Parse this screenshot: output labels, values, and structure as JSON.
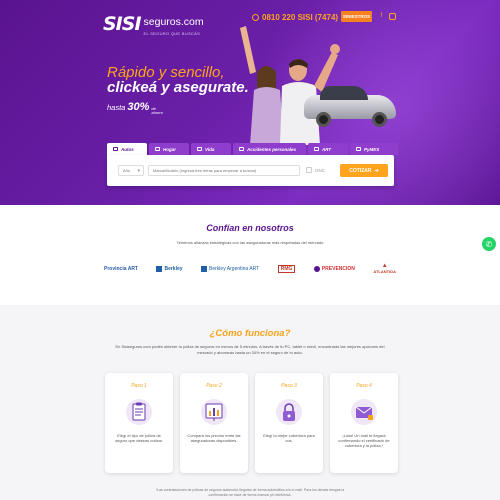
{
  "header": {
    "logo_mark": "SISI",
    "logo_name": "seguros.com",
    "logo_tagline": "EL SEGURO QUE BUSCÁS",
    "phone": "0810 220 SISI (7474)",
    "siniestros_label": "SINIESTROS",
    "social": [
      "facebook-icon",
      "instagram-icon"
    ]
  },
  "hero": {
    "headline_line1": "Rápido y sencillo,",
    "headline_line2": "clickeá y asegurate.",
    "hasta_prefix": "hasta",
    "hasta_value": "30%",
    "hasta_suffix": "de ahorro"
  },
  "tabs": [
    {
      "label": "Autos",
      "active": true
    },
    {
      "label": "Hogar",
      "active": false
    },
    {
      "label": "Vida",
      "active": false
    },
    {
      "label": "Accidentes personales",
      "active": false
    },
    {
      "label": "ART",
      "active": false
    },
    {
      "label": "PyMES",
      "active": false
    }
  ],
  "quote_form": {
    "year_value": "Año",
    "model_placeholder": "Marca/Modelo (Ingresá tres letras para empezar a buscar)",
    "gnc_label": "GNC",
    "cotizar_label": "COTIZAR"
  },
  "confian": {
    "title": "Confían en nosotros",
    "subtitle": "Tenemos alianzas estratégicas con las aseguradoras más respetadas del mercado",
    "logos": [
      {
        "name": "Provincia ART",
        "color": "#2a5ca8"
      },
      {
        "name": "Berkley",
        "color": "#1f5fa6"
      },
      {
        "name": "Berkley Argentina ART",
        "color": "#1f5fa6"
      },
      {
        "name": "RMG",
        "color": "#c0392b"
      },
      {
        "name": "PREVENCION",
        "color": "#d32f2f"
      },
      {
        "name": "ATLANTIDA",
        "color": "#c0392b"
      }
    ]
  },
  "como": {
    "title": "¿Cómo funciona?",
    "subtitle": "En Sisiseguros.com podés obtener tu póliza de seguros en menos de 5 minutos. A través de tu PC, tablet o móvil, encontrarás las mejores opciones del mercado y ahorrarás hasta un 30% en el seguro de tu auto.",
    "steps": [
      {
        "step": "Paso 1",
        "text": "Elegí el tipo de póliza de seguro que deseas cotizar.",
        "icon": "clipboard-icon"
      },
      {
        "step": "Paso 2",
        "text": "Compará los precios entre las aseguradoras disponibles.",
        "icon": "chart-icon"
      },
      {
        "step": "Paso 3",
        "text": "Elegí la mejor cobertura para vos.",
        "icon": "lock-icon"
      },
      {
        "step": "Paso 4",
        "text": "¡Listo! Un mail te llegará confirmando el certificado de cobertura y la póliza.*",
        "icon": "envelope-icon"
      }
    ],
    "footnote": "*Las contrataciones de pólizas de seguros automotor llegarán de forma automática a tu e-mail. Para los demás riesgos la confirmación se hace de forma manual y/o telefónica."
  },
  "colors": {
    "brand_purple": "#5a138f",
    "accent_orange": "#ffa41c",
    "whatsapp": "#25d366"
  }
}
